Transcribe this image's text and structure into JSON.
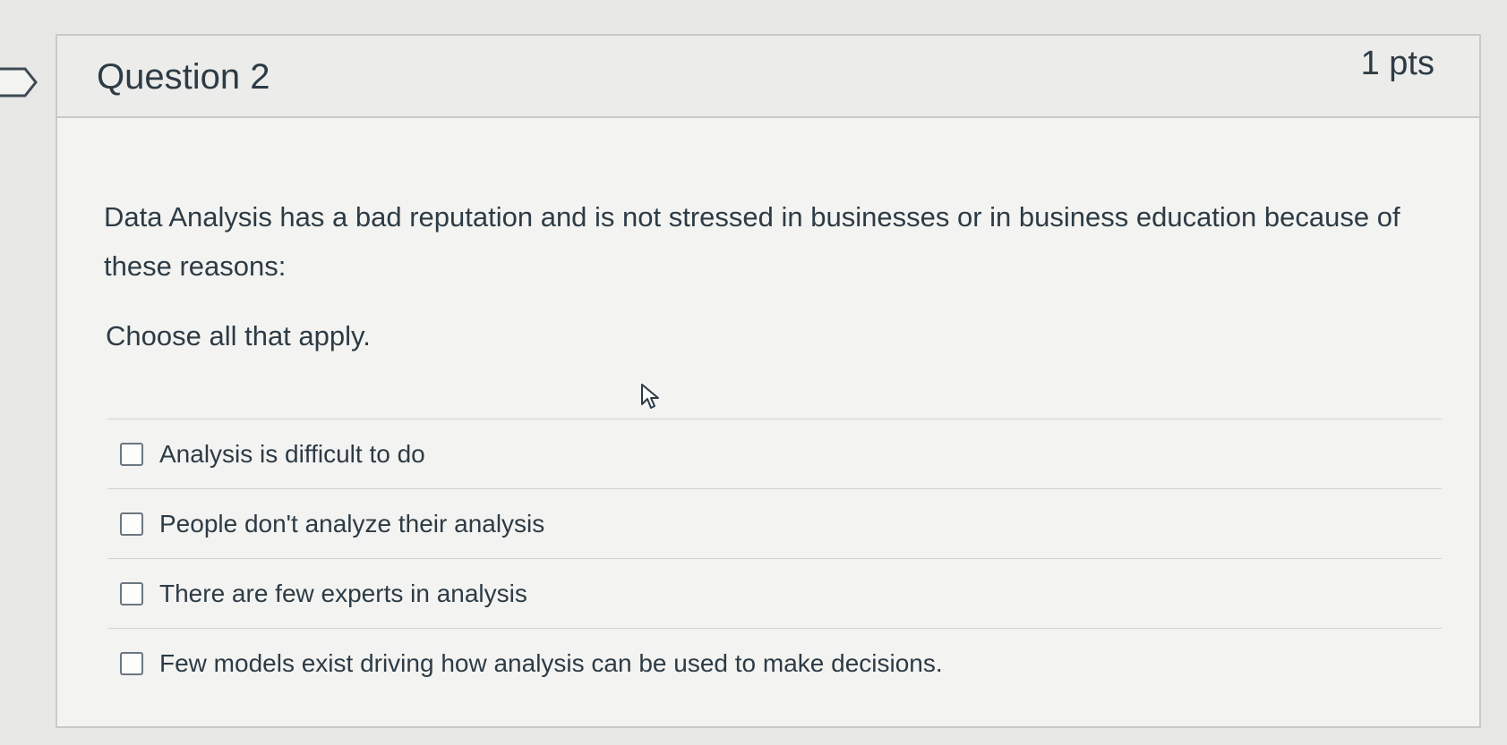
{
  "question": {
    "title": "Question 2",
    "points": "1 pts",
    "text": "Data Analysis has a bad reputation and is not stressed in businesses or in business education because of these reasons:",
    "instruction": "Choose all that apply."
  },
  "answers": [
    {
      "label": "Analysis is difficult to do",
      "checked": false
    },
    {
      "label": "People don't analyze their analysis",
      "checked": false
    },
    {
      "label": "There are few experts in analysis",
      "checked": false
    },
    {
      "label": "Few models exist driving how analysis can be used to make decisions.",
      "checked": false
    }
  ],
  "icons": {
    "flag": "flag-marker-icon",
    "cursor": "mouse-pointer-icon"
  },
  "colors": {
    "text": "#2d3b45",
    "border": "#c9c9c6",
    "header_bg": "#ececea",
    "card_bg": "#f3f3f1"
  }
}
